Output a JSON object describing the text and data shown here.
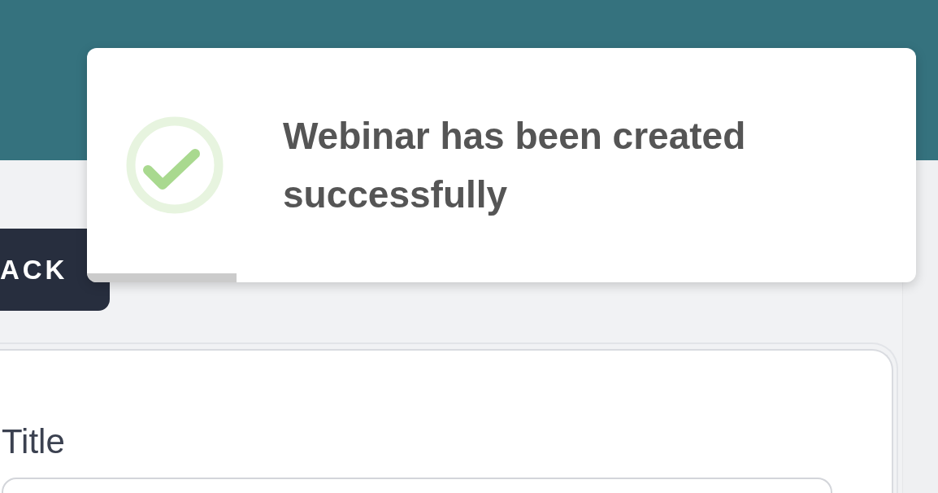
{
  "back_button": {
    "label": "ACK"
  },
  "form": {
    "fields": [
      {
        "label": "Title"
      }
    ]
  },
  "toast": {
    "kind": "success",
    "message": "Webinar has been created successfully",
    "progress": {
      "level": 0.18
    }
  }
}
